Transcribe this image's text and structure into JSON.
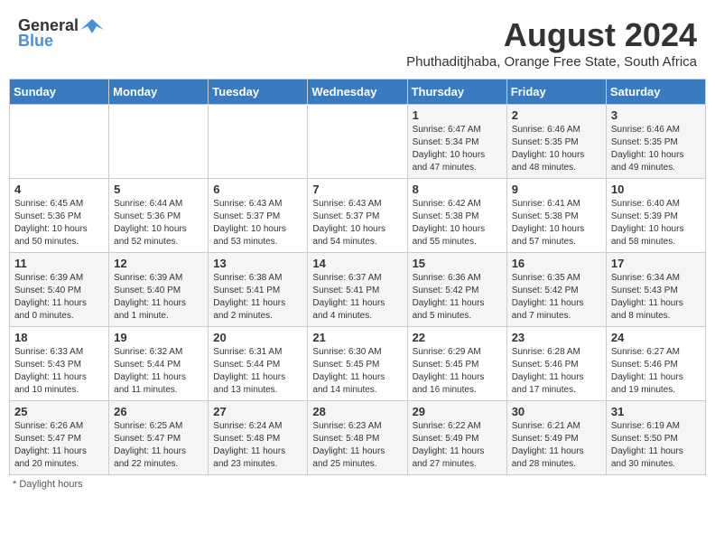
{
  "header": {
    "logo_general": "General",
    "logo_blue": "Blue",
    "main_title": "August 2024",
    "subtitle": "Phuthaditjhaba, Orange Free State, South Africa"
  },
  "days_of_week": [
    "Sunday",
    "Monday",
    "Tuesday",
    "Wednesday",
    "Thursday",
    "Friday",
    "Saturday"
  ],
  "weeks": [
    [
      {
        "day": "",
        "info": ""
      },
      {
        "day": "",
        "info": ""
      },
      {
        "day": "",
        "info": ""
      },
      {
        "day": "",
        "info": ""
      },
      {
        "day": "1",
        "info": "Sunrise: 6:47 AM\nSunset: 5:34 PM\nDaylight: 10 hours and 47 minutes."
      },
      {
        "day": "2",
        "info": "Sunrise: 6:46 AM\nSunset: 5:35 PM\nDaylight: 10 hours and 48 minutes."
      },
      {
        "day": "3",
        "info": "Sunrise: 6:46 AM\nSunset: 5:35 PM\nDaylight: 10 hours and 49 minutes."
      }
    ],
    [
      {
        "day": "4",
        "info": "Sunrise: 6:45 AM\nSunset: 5:36 PM\nDaylight: 10 hours and 50 minutes."
      },
      {
        "day": "5",
        "info": "Sunrise: 6:44 AM\nSunset: 5:36 PM\nDaylight: 10 hours and 52 minutes."
      },
      {
        "day": "6",
        "info": "Sunrise: 6:43 AM\nSunset: 5:37 PM\nDaylight: 10 hours and 53 minutes."
      },
      {
        "day": "7",
        "info": "Sunrise: 6:43 AM\nSunset: 5:37 PM\nDaylight: 10 hours and 54 minutes."
      },
      {
        "day": "8",
        "info": "Sunrise: 6:42 AM\nSunset: 5:38 PM\nDaylight: 10 hours and 55 minutes."
      },
      {
        "day": "9",
        "info": "Sunrise: 6:41 AM\nSunset: 5:38 PM\nDaylight: 10 hours and 57 minutes."
      },
      {
        "day": "10",
        "info": "Sunrise: 6:40 AM\nSunset: 5:39 PM\nDaylight: 10 hours and 58 minutes."
      }
    ],
    [
      {
        "day": "11",
        "info": "Sunrise: 6:39 AM\nSunset: 5:40 PM\nDaylight: 11 hours and 0 minutes."
      },
      {
        "day": "12",
        "info": "Sunrise: 6:39 AM\nSunset: 5:40 PM\nDaylight: 11 hours and 1 minute."
      },
      {
        "day": "13",
        "info": "Sunrise: 6:38 AM\nSunset: 5:41 PM\nDaylight: 11 hours and 2 minutes."
      },
      {
        "day": "14",
        "info": "Sunrise: 6:37 AM\nSunset: 5:41 PM\nDaylight: 11 hours and 4 minutes."
      },
      {
        "day": "15",
        "info": "Sunrise: 6:36 AM\nSunset: 5:42 PM\nDaylight: 11 hours and 5 minutes."
      },
      {
        "day": "16",
        "info": "Sunrise: 6:35 AM\nSunset: 5:42 PM\nDaylight: 11 hours and 7 minutes."
      },
      {
        "day": "17",
        "info": "Sunrise: 6:34 AM\nSunset: 5:43 PM\nDaylight: 11 hours and 8 minutes."
      }
    ],
    [
      {
        "day": "18",
        "info": "Sunrise: 6:33 AM\nSunset: 5:43 PM\nDaylight: 11 hours and 10 minutes."
      },
      {
        "day": "19",
        "info": "Sunrise: 6:32 AM\nSunset: 5:44 PM\nDaylight: 11 hours and 11 minutes."
      },
      {
        "day": "20",
        "info": "Sunrise: 6:31 AM\nSunset: 5:44 PM\nDaylight: 11 hours and 13 minutes."
      },
      {
        "day": "21",
        "info": "Sunrise: 6:30 AM\nSunset: 5:45 PM\nDaylight: 11 hours and 14 minutes."
      },
      {
        "day": "22",
        "info": "Sunrise: 6:29 AM\nSunset: 5:45 PM\nDaylight: 11 hours and 16 minutes."
      },
      {
        "day": "23",
        "info": "Sunrise: 6:28 AM\nSunset: 5:46 PM\nDaylight: 11 hours and 17 minutes."
      },
      {
        "day": "24",
        "info": "Sunrise: 6:27 AM\nSunset: 5:46 PM\nDaylight: 11 hours and 19 minutes."
      }
    ],
    [
      {
        "day": "25",
        "info": "Sunrise: 6:26 AM\nSunset: 5:47 PM\nDaylight: 11 hours and 20 minutes."
      },
      {
        "day": "26",
        "info": "Sunrise: 6:25 AM\nSunset: 5:47 PM\nDaylight: 11 hours and 22 minutes."
      },
      {
        "day": "27",
        "info": "Sunrise: 6:24 AM\nSunset: 5:48 PM\nDaylight: 11 hours and 23 minutes."
      },
      {
        "day": "28",
        "info": "Sunrise: 6:23 AM\nSunset: 5:48 PM\nDaylight: 11 hours and 25 minutes."
      },
      {
        "day": "29",
        "info": "Sunrise: 6:22 AM\nSunset: 5:49 PM\nDaylight: 11 hours and 27 minutes."
      },
      {
        "day": "30",
        "info": "Sunrise: 6:21 AM\nSunset: 5:49 PM\nDaylight: 11 hours and 28 minutes."
      },
      {
        "day": "31",
        "info": "Sunrise: 6:19 AM\nSunset: 5:50 PM\nDaylight: 11 hours and 30 minutes."
      }
    ]
  ],
  "footer": {
    "note": "Daylight hours"
  }
}
